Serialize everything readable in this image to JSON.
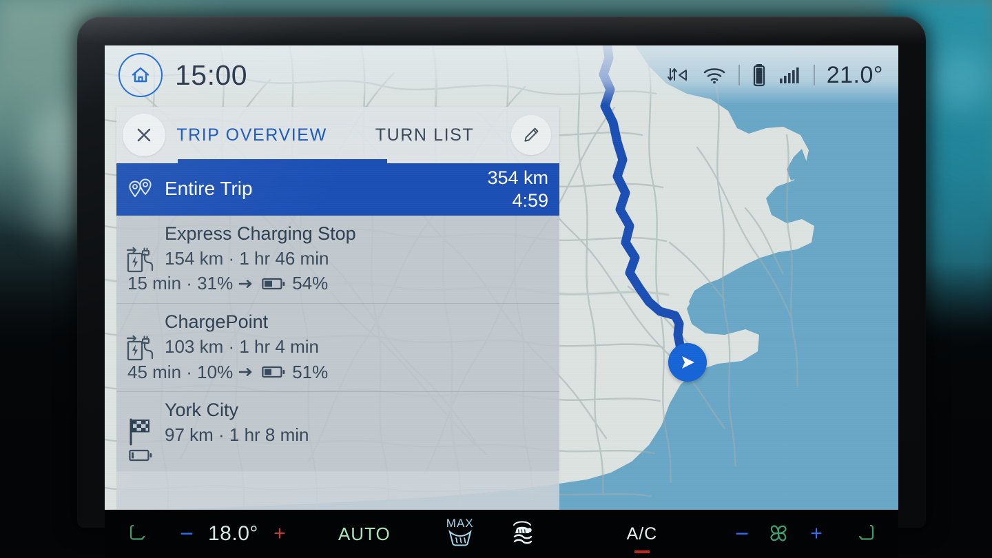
{
  "status_bar": {
    "home_icon": "home-icon",
    "clock": "15:00",
    "icons": [
      "data-transfer-icon",
      "wifi-icon",
      "battery-icon",
      "signal-bars-icon"
    ],
    "exterior_temp": "21.0°"
  },
  "panel": {
    "close_label": "×",
    "tabs": [
      {
        "label": "TRIP OVERVIEW",
        "active": true
      },
      {
        "label": "TURN LIST",
        "active": false
      }
    ],
    "edit_icon": "pencil-icon",
    "rows": [
      {
        "icon": "map-pins-icon",
        "title": "Entire Trip",
        "distance": "354 km",
        "duration": "4:59",
        "selected": true
      },
      {
        "icon": "ev-charging-station-icon",
        "title": "Express Charging Stop",
        "detail": "154 km · 1 hr 46 min",
        "charge_time": "15 min · 31%",
        "arrow": "→",
        "battery_icon": "battery-half-icon",
        "charge_result": "54%",
        "selected": false
      },
      {
        "icon": "ev-charging-station-icon",
        "title": "ChargePoint",
        "detail": "103 km · 1 hr 4 min",
        "charge_time": "45 min · 10%",
        "arrow": "→",
        "battery_icon": "battery-half-icon",
        "charge_result": "51%",
        "selected": false
      },
      {
        "icon": "checkered-flag-icon",
        "title": "York City",
        "detail": "97 km · 1 hr 8 min",
        "battery_icon": "battery-low-icon",
        "selected": false
      }
    ]
  },
  "map": {
    "route_color": "#1a4fb5",
    "land_color": "#dde4e1",
    "sea_color": "#6aa8c8",
    "road_color": "#a8b6b5",
    "vehicle_marker": "vehicle-position-arrow-icon"
  },
  "climate_bar": {
    "driver_seat_icon": "seat-heater-left-icon",
    "temp_minus": "−",
    "driver_temp": "18.0°",
    "temp_plus": "+",
    "auto_label": "AUTO",
    "max_label": "MAX",
    "front_defrost_icon": "max-defrost-icon",
    "rear_defrost_icon": "rear-defrost-icon",
    "ac_label": "A/C",
    "fan_minus": "−",
    "fan_icon": "fan-icon",
    "fan_plus": "+",
    "passenger_seat_icon": "seat-heater-right-icon"
  },
  "colors": {
    "accent_blue": "#1a4fb5",
    "tab_active": "#1457c4",
    "panel_bg": "#bec6cc",
    "text_dark": "#2c3e52"
  }
}
